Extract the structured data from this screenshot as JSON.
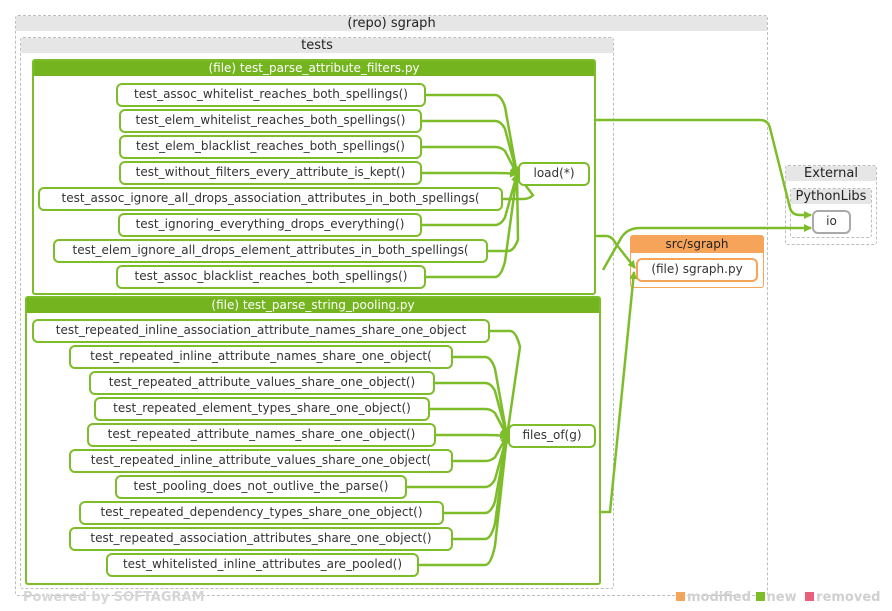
{
  "repo": {
    "title": "(repo) sgraph"
  },
  "tests_folder": {
    "title": "tests"
  },
  "file_filters": {
    "title": "(file) test_parse_attribute_filters.py",
    "functions": [
      "test_assoc_whitelist_reaches_both_spellings()",
      "test_elem_whitelist_reaches_both_spellings()",
      "test_elem_blacklist_reaches_both_spellings()",
      "test_without_filters_every_attribute_is_kept()",
      "test_assoc_ignore_all_drops_association_attributes_in_both_spellings(",
      "test_ignoring_everything_drops_everything()",
      "test_elem_ignore_all_drops_element_attributes_in_both_spellings(",
      "test_assoc_blacklist_reaches_both_spellings()"
    ],
    "target": "load(*)"
  },
  "file_pooling": {
    "title": "(file) test_parse_string_pooling.py",
    "functions": [
      "test_repeated_inline_association_attribute_names_share_one_object",
      "test_repeated_inline_attribute_names_share_one_object(",
      "test_repeated_attribute_values_share_one_object()",
      "test_repeated_element_types_share_one_object()",
      "test_repeated_attribute_names_share_one_object()",
      "test_repeated_inline_attribute_values_share_one_object(",
      "test_pooling_does_not_outlive_the_parse()",
      "test_repeated_dependency_types_share_one_object()",
      "test_repeated_association_attributes_share_one_object()",
      "test_whitelisted_inline_attributes_are_pooled()"
    ],
    "target": "files_of(g)"
  },
  "src": {
    "title": "src/sgraph",
    "file": "(file) sgraph.py"
  },
  "external": {
    "title": "External",
    "sub_title": "PythonLibs",
    "node": "io"
  },
  "footer": {
    "powered_by": "Powered by SOFTAGRAM",
    "legend": [
      {
        "label": "modified",
        "color": "#f4a55c"
      },
      {
        "label": "new",
        "color": "#7dbd2a"
      },
      {
        "label": "removed",
        "color": "#e8607a"
      }
    ]
  },
  "colors": {
    "edge": "#7dbd2a",
    "orange": "#f6a45a",
    "header_green": "#73b41f"
  }
}
